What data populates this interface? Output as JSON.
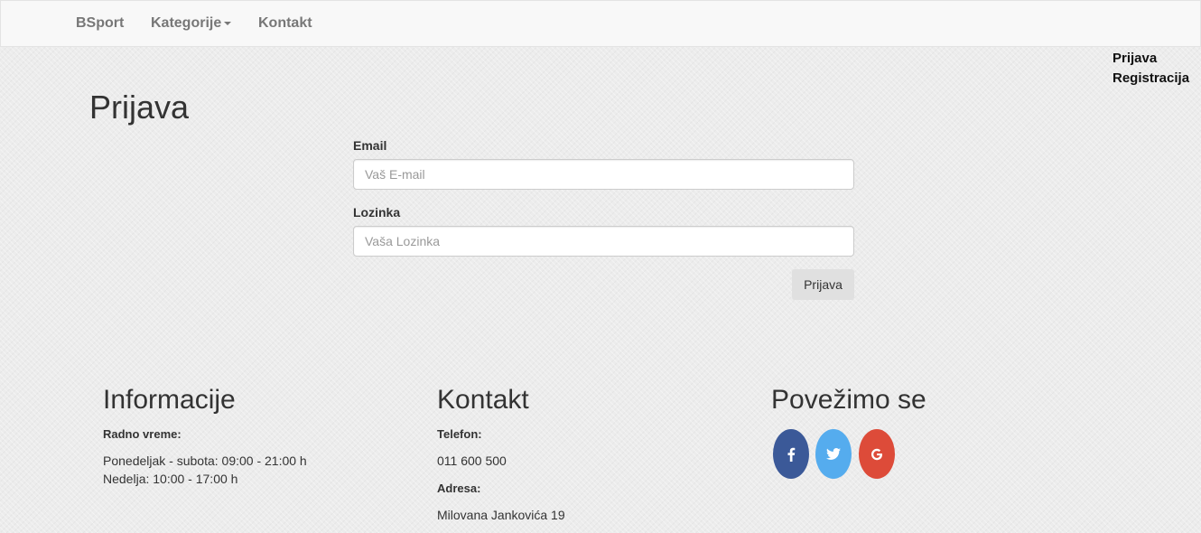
{
  "navbar": {
    "brand": "BSport",
    "categories_label": "Kategorije",
    "contact_label": "Kontakt"
  },
  "auth_links": {
    "login": "Prijava",
    "register": "Registracija"
  },
  "login_form": {
    "title": "Prijava",
    "email_label": "Email",
    "email_placeholder": "Vaš E-mail",
    "email_value": "",
    "password_label": "Lozinka",
    "password_placeholder": "Vaša Lozinka",
    "password_value": "",
    "submit_label": "Prijava"
  },
  "footer": {
    "info": {
      "heading": "Informacije",
      "hours_label": "Radno vreme:",
      "weekdays": "Ponedeljak - subota: 09:00 - 21:00 h",
      "sunday": "Nedelja: 10:00 - 17:00 h"
    },
    "contact": {
      "heading": "Kontakt",
      "phone_label": "Telefon:",
      "phone": "011 600 500",
      "address_label": "Adresa:",
      "address": "Milovana Jankovića 19"
    },
    "social": {
      "heading": "Povežimo se",
      "icons": [
        "facebook-icon",
        "twitter-icon",
        "google-icon"
      ],
      "colors": {
        "facebook": "#3b5998",
        "twitter": "#55acee",
        "google": "#dd4b39"
      }
    }
  }
}
